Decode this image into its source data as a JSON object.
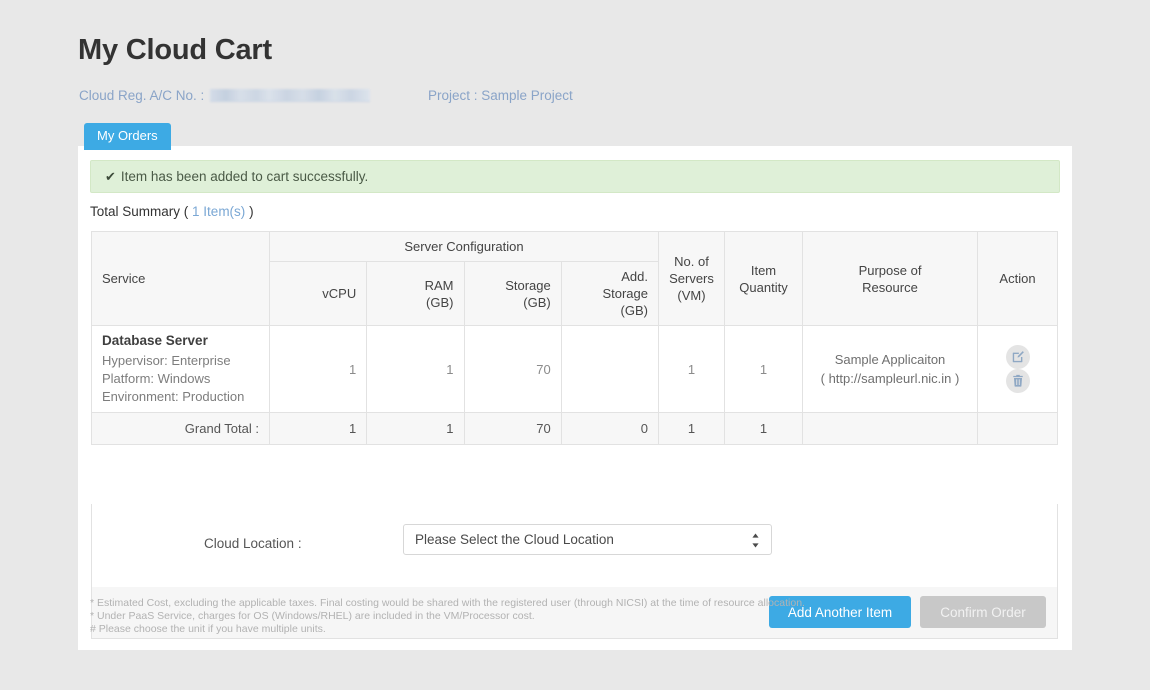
{
  "header": {
    "title": "My Cloud Cart",
    "account_label": "Cloud Reg. A/C No. :",
    "account_value_redacted": "",
    "project": "Project : Sample Project"
  },
  "tabs": [
    {
      "label": "My Orders",
      "active": true
    }
  ],
  "alert": {
    "icon": "check-icon",
    "message": "Item has been added to cart successfully.",
    "bg_color": "#dff0d8"
  },
  "summary": {
    "label": "Total Summary (",
    "count": "1 Item(s)",
    "label_end": ")"
  },
  "table": {
    "group_headers": {
      "service": "Service",
      "server_configuration": "Server Configuration",
      "servers": "No. of\nServers\n(VM)",
      "servers_l1": "No. of",
      "servers_l2": "Servers",
      "servers_l3": "(VM)",
      "item_qty_l1": "Item",
      "item_qty_l2": "Quantity",
      "purpose_l1": "Purpose of",
      "purpose_l2": "Resource",
      "action": "Action"
    },
    "sub_headers": {
      "vcpu": "vCPU",
      "ram_l1": "RAM",
      "ram_l2": "(GB)",
      "storage_l1": "Storage",
      "storage_l2": "(GB)",
      "add_storage_l1": "Add.",
      "add_storage_l2": "Storage (GB)"
    },
    "rows": [
      {
        "service_name": "Database Server",
        "service_hypervisor": "Hypervisor: Enterprise",
        "service_platform": "Platform: Windows",
        "service_environment": "Environment: Production",
        "vcpu": "1",
        "ram": "1",
        "storage": "70",
        "add_storage": "",
        "servers": "1",
        "item_quantity": "1",
        "purpose_l1": "Sample Applicaiton",
        "purpose_l2": "( http://sampleurl.nic.in )",
        "actions": [
          "edit-icon",
          "delete-icon"
        ]
      }
    ],
    "grand_total": {
      "label": "Grand Total :",
      "vcpu": "1",
      "ram": "1",
      "storage": "70",
      "add_storage": "0",
      "servers": "1",
      "item_quantity": "1",
      "purpose": "",
      "action": ""
    }
  },
  "cloud_location": {
    "label": "Cloud Location :",
    "selected": "Please Select the Cloud Location"
  },
  "buttons": {
    "add_another": "Add Another Item",
    "confirm_order": "Confirm Order",
    "confirm_disabled": true,
    "primary_color": "#3daae4",
    "disabled_color": "#c8c8c8"
  },
  "footnotes": [
    "* Estimated Cost, excluding the applicable taxes. Final costing would be shared with the registered user (through NICSI) at the time of resource allocation.",
    "* Under PaaS Service, charges for OS (Windows/RHEL) are included in the VM/Processor cost.",
    "# Please choose the unit if you have multiple units."
  ]
}
